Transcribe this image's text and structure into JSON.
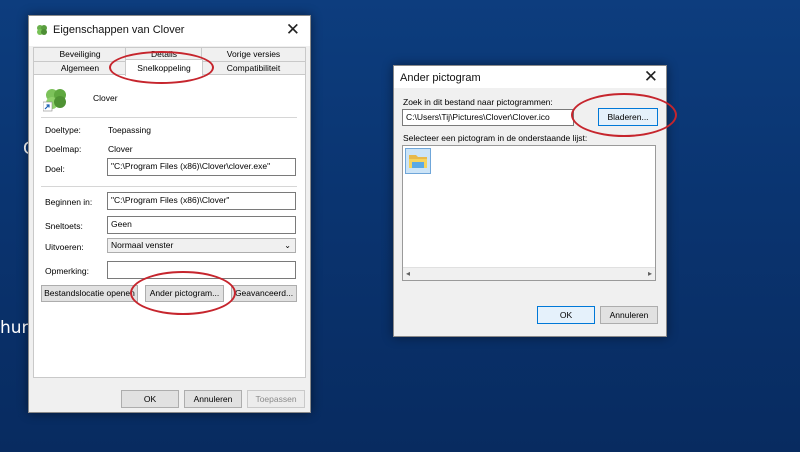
{
  "desktop": {
    "partial_text_top": "C",
    "partial_text_mid": "hur"
  },
  "properties_dialog": {
    "title": "Eigenschappen van Clover",
    "close_glyph": "✕",
    "tabs_row1": [
      "Beveiliging",
      "Details",
      "Vorige versies"
    ],
    "tabs_row2": [
      "Algemeen",
      "Snelkoppeling",
      "Compatibiliteit"
    ],
    "active_tab": "Snelkoppeling",
    "app_name": "Clover",
    "icon": "clover-shortcut-icon",
    "fields": {
      "doeltype_label": "Doeltype:",
      "doeltype_value": "Toepassing",
      "doelmap_label": "Doelmap:",
      "doelmap_value": "Clover",
      "doel_label": "Doel:",
      "doel_value": "\"C:\\Program Files (x86)\\Clover\\clover.exe\"",
      "beginnen_label": "Beginnen in:",
      "beginnen_value": "\"C:\\Program Files (x86)\\Clover\"",
      "sneltoets_label": "Sneltoets:",
      "sneltoets_value": "Geen",
      "uitvoeren_label": "Uitvoeren:",
      "uitvoeren_value": "Normaal venster",
      "opmerking_label": "Opmerking:",
      "opmerking_value": ""
    },
    "buttons": {
      "bestandslocatie": "Bestandslocatie openen",
      "ander_pictogram": "Ander pictogram...",
      "geavanceerd": "Geavanceerd...",
      "ok": "OK",
      "annuleren": "Annuleren",
      "toepassen": "Toepassen"
    }
  },
  "icon_dialog": {
    "title": "Ander pictogram",
    "close_glyph": "✕",
    "search_label": "Zoek in dit bestand naar pictogrammen:",
    "path_value": "C:\\Users\\Tij\\Pictures\\Clover\\Clover.ico",
    "browse_button": "Bladeren...",
    "list_label": "Selecteer een pictogram in de onderstaande lijst:",
    "list_icons": [
      "folder-icon"
    ],
    "ok_button": "OK",
    "cancel_button": "Annuleren"
  },
  "annotation_color": "#c6252d"
}
